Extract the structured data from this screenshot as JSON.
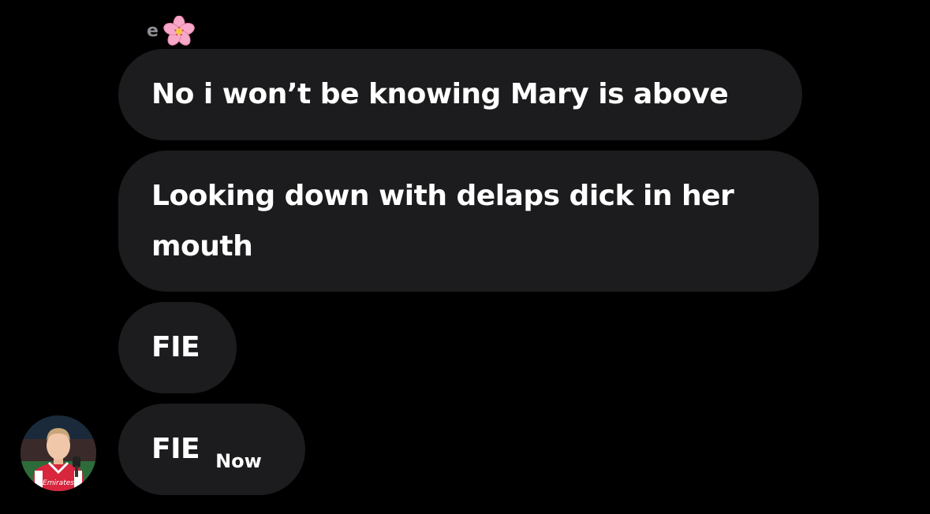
{
  "sender": {
    "name": "e",
    "emoji_icon": "cherry-blossom-icon"
  },
  "messages": [
    {
      "text": "No i won’t be knowing Mary is above"
    },
    {
      "text": "Looking down with delaps dick in her mouth"
    },
    {
      "text": "FIE"
    },
    {
      "text": "FIE",
      "timestamp": "Now"
    }
  ],
  "avatar": {
    "shirt_text": "Emirates"
  },
  "colors": {
    "background": "#000000",
    "bubble": "#1c1c1e",
    "text": "#ffffff",
    "sender_name": "#8e8e93",
    "flower_petal": "#f7a8c8",
    "flower_center": "#f5c542"
  }
}
